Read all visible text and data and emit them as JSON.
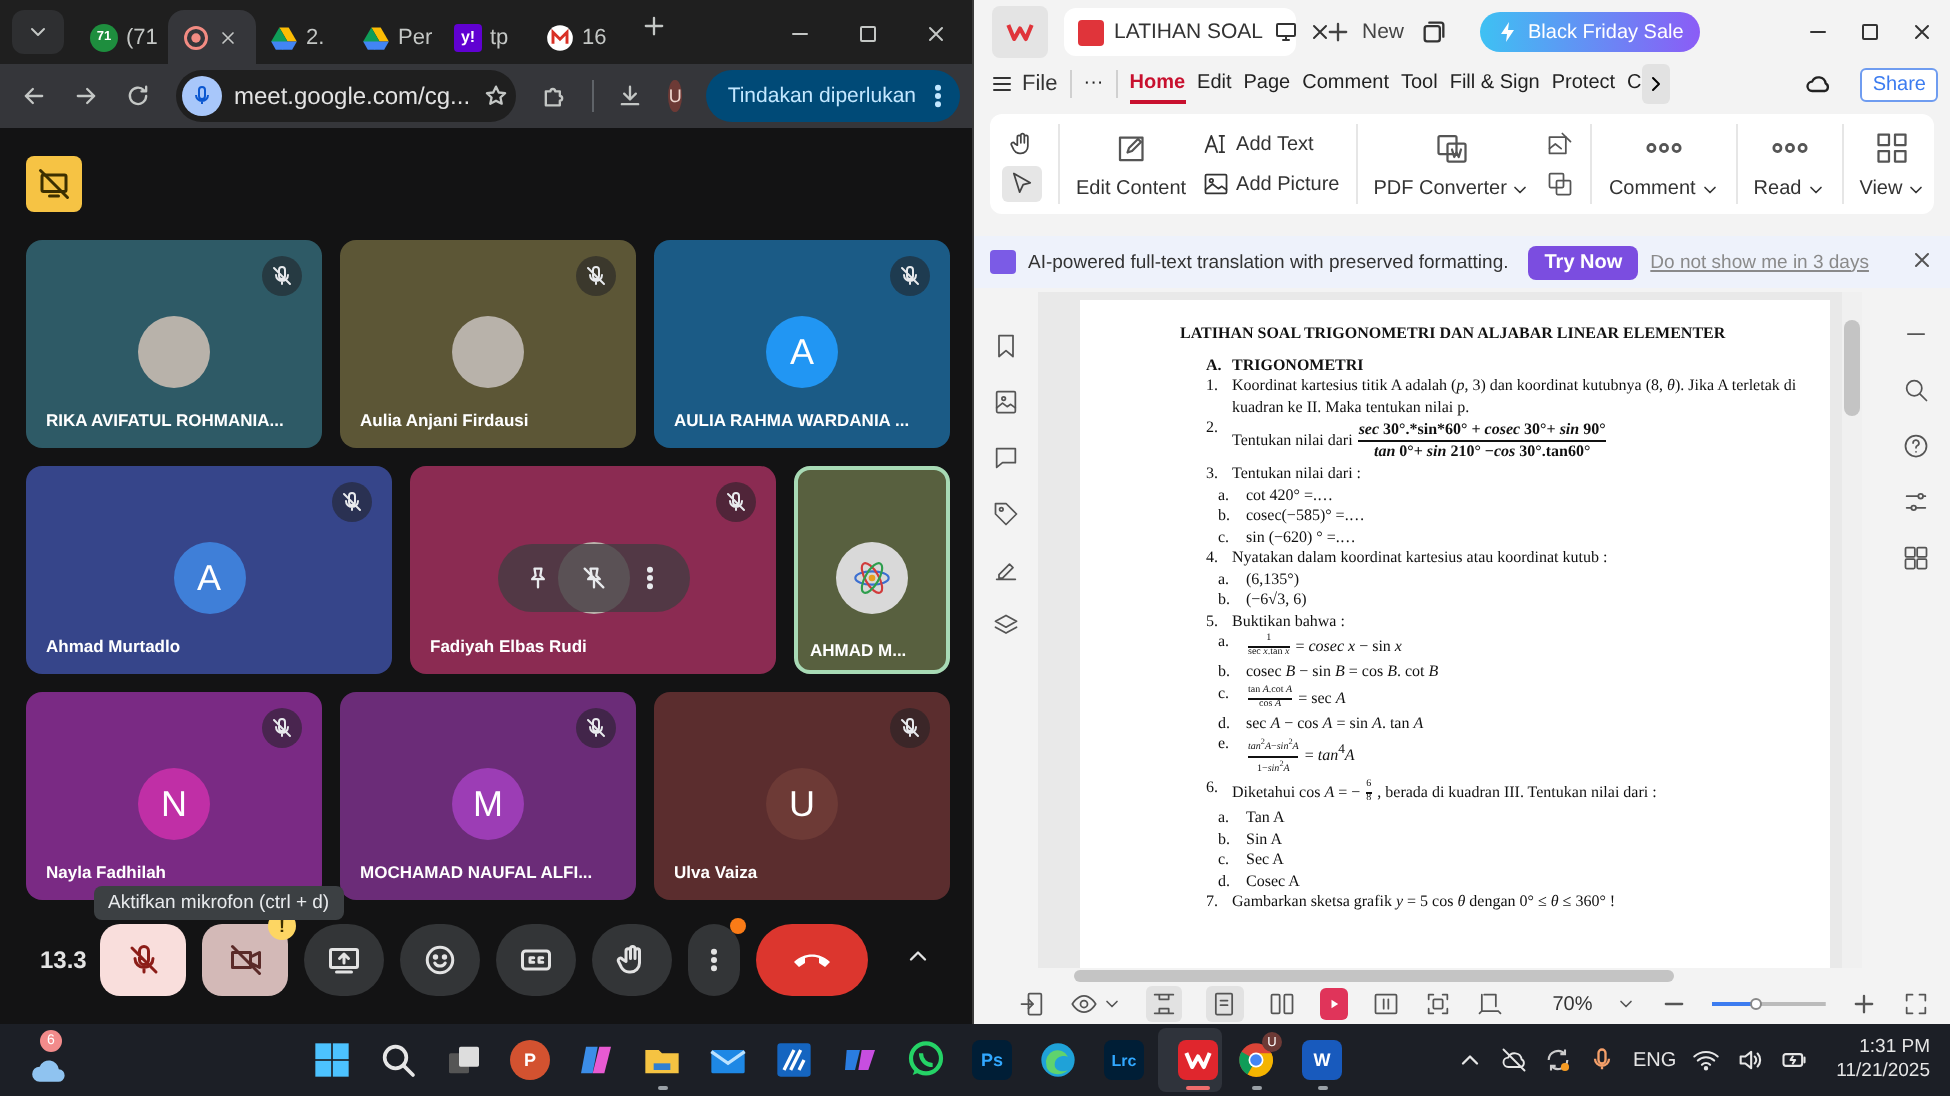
{
  "browser": {
    "tabs": [
      {
        "kind": "chat",
        "badge": "71",
        "title": "(71",
        "selected": false
      },
      {
        "kind": "record",
        "selected": true
      },
      {
        "kind": "drive",
        "title": "2.",
        "selected": false
      },
      {
        "kind": "drive",
        "title": "Per",
        "selected": false
      },
      {
        "kind": "yahoo",
        "logo": "y!",
        "title": "tp",
        "selected": false
      },
      {
        "kind": "mail",
        "title": "16",
        "selected": false
      }
    ],
    "url": "meet.google.com/cg...",
    "profile": "U",
    "action_button": "Tindakan diperlukan"
  },
  "meet": {
    "rows": [
      [
        {
          "name": "RIKA AVIFATUL ROHMANIA...",
          "color": "#2e5a66",
          "avatar": {
            "kind": "photo"
          },
          "muted": true,
          "hovered": false,
          "highlighted": false
        },
        {
          "name": "Aulia Anjani Firdausi",
          "color": "#5c5636",
          "avatar": {
            "kind": "photo"
          },
          "muted": true,
          "hovered": false,
          "highlighted": false
        },
        {
          "name": "AULIA RAHMA WARDANIA ...",
          "color": "#1b5b86",
          "avatar": {
            "kind": "letter",
            "letter": "A",
            "color": "#2196f3"
          },
          "muted": true,
          "hovered": false,
          "highlighted": false
        }
      ],
      [
        {
          "name": "Ahmad Murtadlo",
          "color": "#36458a",
          "avatar": {
            "kind": "letter",
            "letter": "A",
            "color": "#3f7fd8"
          },
          "muted": true,
          "hovered": false,
          "highlighted": false
        },
        {
          "name": "Fadiyah Elbas Rudi",
          "color": "#8b2b52",
          "avatar": {
            "kind": "photo"
          },
          "muted": true,
          "hovered": true,
          "highlighted": false
        },
        {
          "name": "AHMAD M...",
          "color": "#58603f",
          "avatar": {
            "kind": "logo"
          },
          "muted": false,
          "hovered": false,
          "highlighted": true
        }
      ],
      [
        {
          "name": "Nayla Fadhilah",
          "color": "#7a2a84",
          "avatar": {
            "kind": "letter",
            "letter": "N",
            "color": "#c02fa6"
          },
          "muted": true,
          "hovered": false,
          "highlighted": false
        },
        {
          "name": "MOCHAMAD NAUFAL ALFI...",
          "color": "#6b2c78",
          "avatar": {
            "kind": "letter",
            "letter": "M",
            "color": "#9c3db5"
          },
          "muted": true,
          "hovered": false,
          "highlighted": false
        },
        {
          "name": "Ulva Vaiza",
          "color": "#5b2d2e",
          "avatar": {
            "kind": "letter",
            "letter": "U",
            "color": "#6d3a36"
          },
          "muted": true,
          "hovered": false,
          "highlighted": false
        }
      ]
    ],
    "timer": "13.3",
    "tooltip": "Aktifkan mikrofon (ctrl + d)",
    "mic_on": false,
    "camera_on": false,
    "camera_warning": "!",
    "more_alert": true
  },
  "pdf_app": {
    "tab_title": "LATIHAN SOAL",
    "new_tab": "New",
    "promo": "Black Friday Sale",
    "file_menu": "File",
    "more_menu": "···",
    "menu": [
      {
        "label": "Home",
        "selected": true
      },
      {
        "label": "Edit",
        "selected": false
      },
      {
        "label": "Page",
        "selected": false
      },
      {
        "label": "Comment",
        "selected": false
      },
      {
        "label": "Tool",
        "selected": false
      },
      {
        "label": "Fill & Sign",
        "selected": false
      },
      {
        "label": "Protect",
        "selected": false
      },
      {
        "label": "C",
        "selected": false
      }
    ],
    "share": "Share",
    "ribbon": [
      {
        "kind": "edit",
        "label": "Edit Content",
        "dropdown": false
      },
      {
        "kind": "text",
        "label": "Add Text",
        "dropdown": false
      },
      {
        "kind": "picture",
        "label": "Add Picture",
        "dropdown": false
      },
      {
        "kind": "convert",
        "label": "PDF Converter",
        "dropdown": true
      },
      {
        "kind": "comment",
        "label": "Comment",
        "dropdown": true
      },
      {
        "kind": "read",
        "label": "Read",
        "dropdown": true
      },
      {
        "kind": "view",
        "label": "View",
        "dropdown": true
      }
    ],
    "banner": {
      "text": "AI-powered full-text translation with preserved formatting.",
      "button": "Try Now",
      "link": "Do not show me in 3 days"
    },
    "document": [
      {
        "kind": "title",
        "text": "LATIHAN SOAL TRIGONOMETRI DAN ALJABAR LINEAR ELEMENTER"
      },
      {
        "kind": "heading",
        "marker": "A.",
        "text": "TRIGONOMETRI"
      },
      {
        "kind": "item",
        "marker": "1.",
        "text": "Koordinat kartesius titik A adalah (*p*, 3) dan koordinat kutubnya (8, *θ*). Jika A terletak di kuadran ke II. Maka tentukan nilai p."
      },
      {
        "kind": "item",
        "marker": "2.",
        "text": "Tentukan  nilai dari",
        "fraction": {
          "kind": "display",
          "numerator": "*sec* 30°.*sin*60° + *cosec* 30°+ *sin* 90°",
          "denominator": "*tan* 0°+ *sin*  210° −*cos* 30°.tan60°"
        }
      },
      {
        "kind": "item",
        "marker": "3.",
        "text": "Tentukan nilai dari :"
      },
      {
        "kind": "sub",
        "marker": "a.",
        "text": "cot 420° =.…"
      },
      {
        "kind": "sub",
        "marker": "b.",
        "text": "cosec(−585)° =.…"
      },
      {
        "kind": "sub",
        "marker": "c.",
        "text": "sin (−620) ° =.…"
      },
      {
        "kind": "item",
        "marker": "4.",
        "text": "Nyatakan dalam koordinat kartesius atau koordinat kutub :"
      },
      {
        "kind": "sub",
        "marker": "a.",
        "text": "(6,135°)"
      },
      {
        "kind": "sub",
        "marker": "b.",
        "text": "(−6√3, 6)"
      },
      {
        "kind": "item",
        "marker": "5.",
        "text": "Buktikan bahwa :"
      },
      {
        "kind": "sub",
        "marker": "a.",
        "fraction": {
          "kind": "inline",
          "numerator": "1",
          "denominator": "sec *x*.tan *x*"
        },
        "after": "= *cosec x* − sin *x*"
      },
      {
        "kind": "sub",
        "marker": "b.",
        "text": "cosec *B* − sin *B* = cos *B*. cot *B*"
      },
      {
        "kind": "sub",
        "marker": "c.",
        "fraction": {
          "kind": "inline",
          "numerator": "tan *A*.cot *A*",
          "denominator": "cos *A*"
        },
        "after": "= sec *A*"
      },
      {
        "kind": "sub",
        "marker": "d.",
        "text": "sec *A* − cos *A* = sin *A*. tan *A*"
      },
      {
        "kind": "sub",
        "marker": "e.",
        "fraction": {
          "kind": "inline",
          "numerator": "*tan*$^{2}$*A*−*sin*$^{2}$*A*",
          "denominator": "1−*sin*$^{2}$*A*"
        },
        "after": "= *tan*$^{4}$*A*"
      },
      {
        "kind": "item",
        "marker": "6.",
        "text": "Diketahui cos *A* = −",
        "fraction": {
          "kind": "inline",
          "numerator": "6",
          "denominator": "8"
        },
        "after": ", berada di kuadran III. Tentukan nilai dari :"
      },
      {
        "kind": "sub",
        "marker": "a.",
        "text": "Tan A"
      },
      {
        "kind": "sub",
        "marker": "b.",
        "text": "Sin A"
      },
      {
        "kind": "sub",
        "marker": "c.",
        "text": "Sec A"
      },
      {
        "kind": "sub",
        "marker": "d.",
        "text": "Cosec A"
      },
      {
        "kind": "item",
        "marker": "7.",
        "text": "Gambarkan sketsa grafik *y* = 5 cos *θ*  dengan 0° ≤ *θ* ≤ 360° !"
      }
    ],
    "zoom": "70%",
    "zoom_slider": {
      "level": 0.38
    }
  },
  "taskbar": {
    "weather_badge": "6",
    "apps": [
      {
        "kind": "start",
        "running": false,
        "active": false
      },
      {
        "kind": "search",
        "running": false,
        "active": false
      },
      {
        "kind": "taskview",
        "running": false,
        "active": false
      },
      {
        "kind": "powerpoint",
        "label": "P",
        "running": false,
        "active": false
      },
      {
        "kind": "copilot",
        "running": false,
        "active": false
      },
      {
        "kind": "explorer",
        "running": true,
        "active": false
      },
      {
        "kind": "mail",
        "running": false,
        "active": false
      },
      {
        "kind": "editor",
        "running": false,
        "active": false
      },
      {
        "kind": "m365",
        "running": false,
        "active": false
      },
      {
        "kind": "whatsapp",
        "running": false,
        "active": false
      },
      {
        "kind": "photoshop",
        "label": "Ps",
        "running": false,
        "active": false
      },
      {
        "kind": "edge",
        "running": false,
        "active": false
      },
      {
        "kind": "lightroom",
        "label": "Lrc",
        "running": false,
        "active": false
      },
      {
        "kind": "wps",
        "running": true,
        "active": true
      },
      {
        "kind": "chrome",
        "badge": "U",
        "running": true,
        "active": false
      },
      {
        "kind": "word",
        "label": "W",
        "running": true,
        "active": false
      }
    ],
    "language": "ENG",
    "time": "1:31 PM",
    "date": "11/21/2025"
  }
}
